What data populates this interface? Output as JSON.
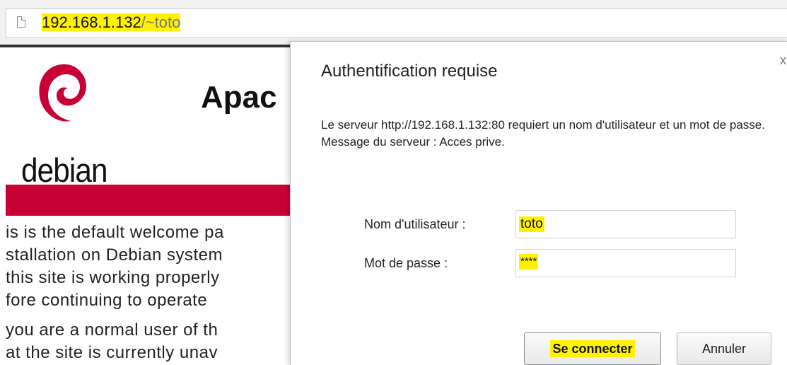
{
  "address_bar": {
    "url_host": "192.168.1.132",
    "url_path": "/~toto",
    "highlight_color": "#fff200"
  },
  "background_page": {
    "logo_icon": "debian-swirl-icon",
    "logo_text": "debian",
    "heading": "Apac",
    "accent_color": "#c70036",
    "lines": [
      "is is the default welcome pa",
      "stallation on Debian system",
      " this site is working properly",
      "fore continuing to operate",
      "you are a normal user of th",
      "at the site is currently unav"
    ]
  },
  "dialog": {
    "close_label": "x",
    "title": "Authentification requise",
    "message": "Le serveur http://192.168.1.132:80 requiert un nom d'utilisateur et un mot de passe. Message du serveur : Acces prive.",
    "username_label": "Nom d'utilisateur :",
    "username_value": "toto",
    "password_label": "Mot de passe :",
    "password_value": "****",
    "login_button": "Se connecter",
    "cancel_button": "Annuler"
  }
}
